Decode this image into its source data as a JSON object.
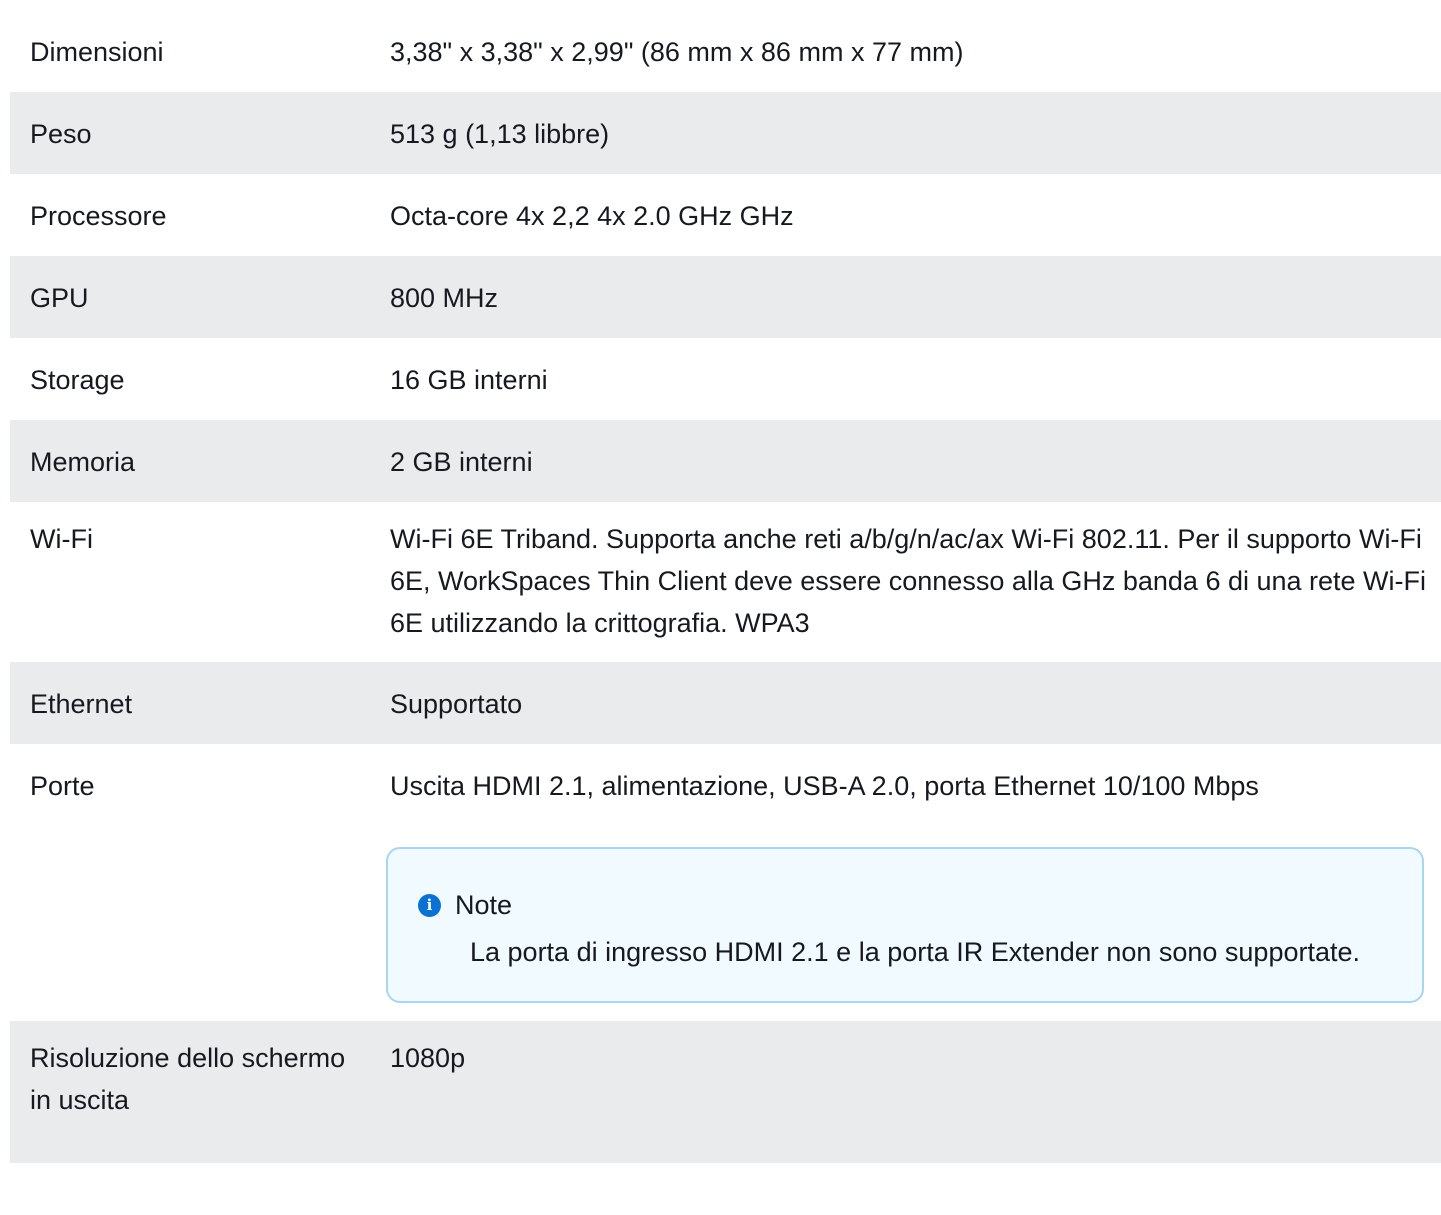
{
  "specs": {
    "rows": [
      {
        "label": "Dimensioni",
        "value": "3,38\" x 3,38\" x 2,99\" (86 mm x 86 mm x 77 mm)"
      },
      {
        "label": "Peso",
        "value": "513 g (1,13 libbre)"
      },
      {
        "label": "Processore",
        "value": "Octa-core 4x 2,2 4x 2.0 GHz GHz"
      },
      {
        "label": "GPU",
        "value": "800 MHz"
      },
      {
        "label": "Storage",
        "value": "16 GB interni"
      },
      {
        "label": "Memoria",
        "value": "2 GB interni"
      },
      {
        "label": "Wi-Fi",
        "value": "Wi-Fi 6E Triband. Supporta anche reti a/b/g/n/ac/ax Wi-Fi 802.11. Per il supporto Wi-Fi 6E, WorkSpaces Thin Client deve essere connesso alla GHz banda 6 di una rete Wi-Fi 6E utilizzando la crittografia. WPA3"
      },
      {
        "label": "Ethernet",
        "value": "Supportato"
      },
      {
        "label": "Porte",
        "value": "Uscita HDMI 2.1, alimentazione, USB-A 2.0, porta Ethernet 10/100 Mbps"
      },
      {
        "label": "Risoluzione dello schermo in uscita",
        "value": "1080p"
      }
    ],
    "note": {
      "icon": "info-icon",
      "title": "Note",
      "body": "La porta di ingresso HDMI 2.1 e la porta IR Extender non sono supportate."
    }
  },
  "colors": {
    "alt_row": "#e9ebed",
    "note_border": "#a8d6ef",
    "note_bg": "#f1faff",
    "info_icon": "#0972d3"
  }
}
